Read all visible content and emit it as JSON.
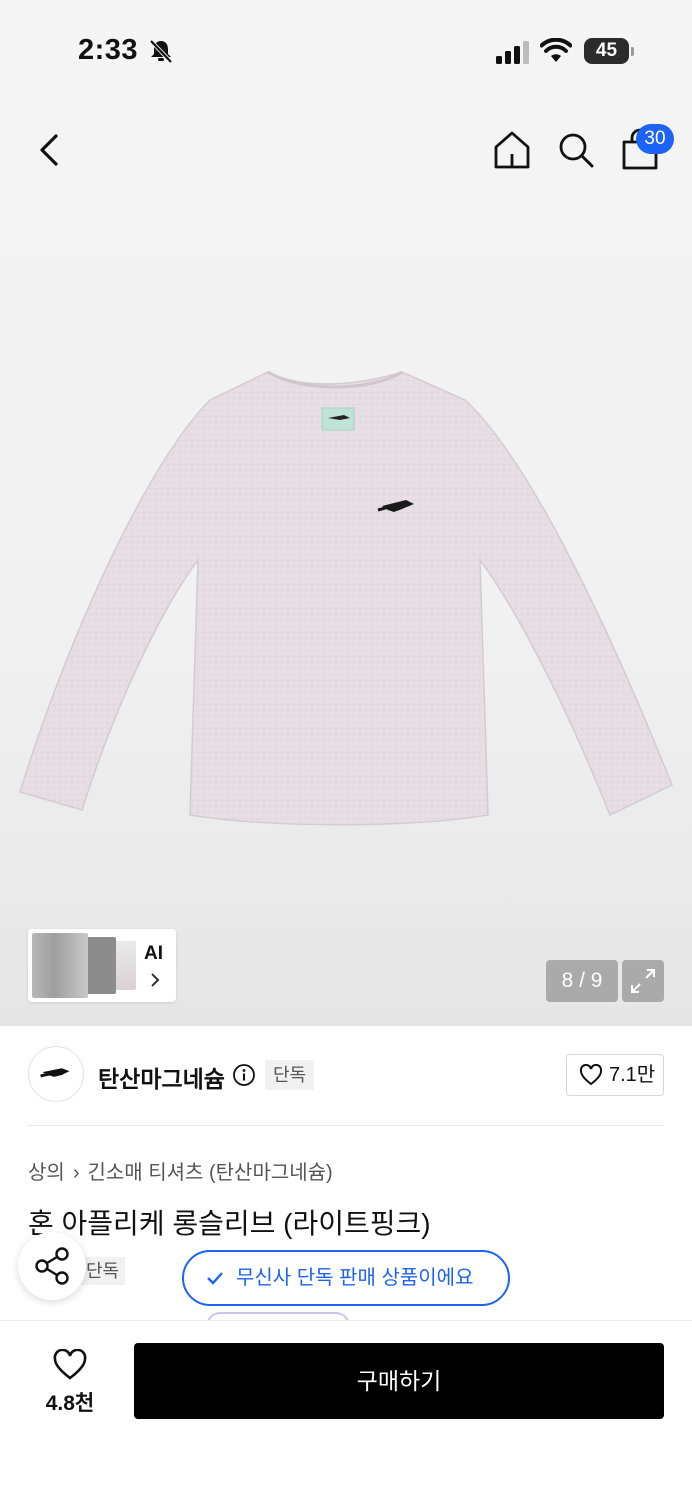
{
  "status_bar": {
    "time": "2:33",
    "battery": "45"
  },
  "nav": {
    "cart_count": "30"
  },
  "gallery": {
    "ai_label": "AI",
    "counter": "8 / 9"
  },
  "brand": {
    "name": "탄산마그네슘",
    "badge": "단독",
    "likes": "7.1만"
  },
  "product": {
    "breadcrumb": [
      "상의",
      "긴소매 티셔츠 (탄산마그네슘)"
    ],
    "title": "혼 아플리케 롱슬리브 (라이트핑크)",
    "exclusive_chip": "단독",
    "exclusive_banner": "무신사 단독 판매 상품이에요"
  },
  "bottom_bar": {
    "wish_count": "4.8천",
    "buy_label": "구매하기"
  },
  "colors": {
    "accent": "#1d63f5",
    "buy_button": "#000000",
    "shirt": "#e4dde2"
  }
}
